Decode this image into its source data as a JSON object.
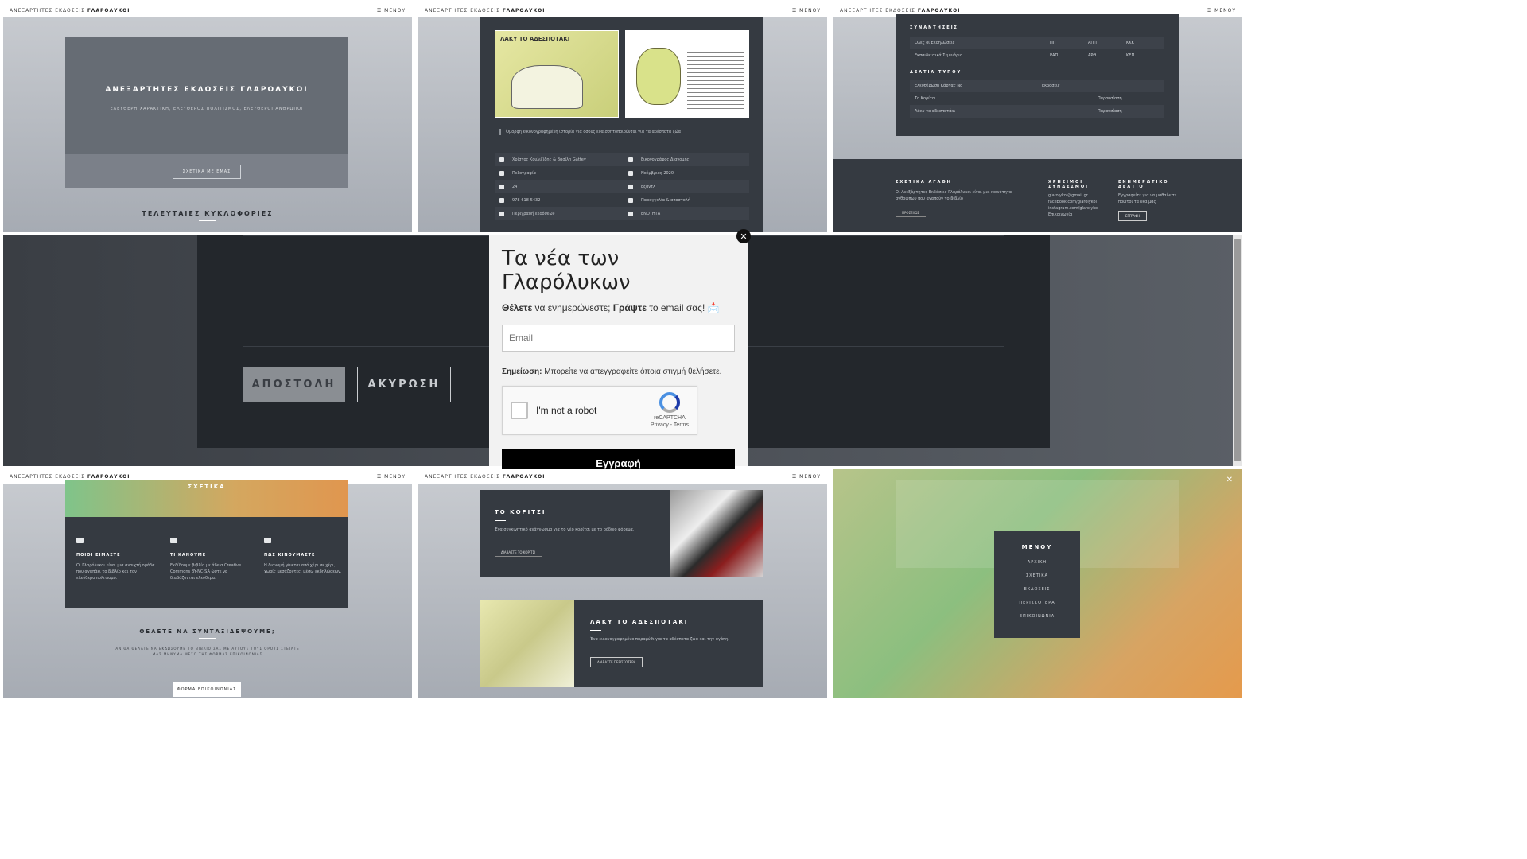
{
  "topbar": {
    "brand_prefix": "ΑΝΕΞΑΡΤΗΤΕΣ ΕΚΔΟΣΕΙΣ",
    "brand_name": "ΓΛΑΡΟΛΥΚΟΙ",
    "menu_label": "☰ ΜΕΝΟΥ"
  },
  "hero": {
    "title": "ΑΝΕΞΑΡΤΗΤΕΣ ΕΚΔΟΣΕΙΣ ΓΛΑΡΟΛΥΚΟΙ",
    "subtitle": "ΕΛΕΥΘΕΡΗ ΧΑΡΑΚΤΙΚΗ, ΕΛΕΥΘΕΡΟΣ ΠΟΛΙΤΙΣΜΟΣ, ΕΛΕΥΘΕΡΟΙ ΑΝΘΡΩΠΟΙ",
    "about_button": "ΣΧΕΤΙΚΑ ΜΕ ΕΜΑΣ",
    "latest_heading": "ΤΕΛΕΥΤΑΙΕΣ ΚΥΚΛΟΦΟΡΙΕΣ"
  },
  "book": {
    "cover_title": "ΛΑΚΥ ΤΟ ΑΔΕΣΠΟΤΑΚΙ",
    "description": "Όμορφη εικονογραφημένη ιστορία για όσους ευαισθητοποιούνται για τα αδέσποτα ζώα",
    "details": [
      {
        "left": "Χρίστος Κουλιζίδης & Βασίλη Gattey",
        "right": "Εικονογράφος Διανομής"
      },
      {
        "left": "Πεζογραφία",
        "right": "Νοέμβριος 2020"
      },
      {
        "left": "24",
        "right": "Εξαντλ"
      },
      {
        "left": "978-618-5432",
        "right": "Παραγγελία & αποστολή"
      },
      {
        "left": "Περιγραφή εκδόσεων",
        "right": "ΕΝΟΤΗΤΑ"
      }
    ]
  },
  "meetings": {
    "heading": "ΣΥΝΑΝΤΗΣΕΙΣ",
    "rows": [
      {
        "name": "Όλες οι Εκδηλώσεις",
        "a": "ΠΠ",
        "b": "ΑΠΠ",
        "c": "ΚΚΚ"
      },
      {
        "name": "Εκπαιδευτικά Σεμινάρια",
        "a": "ΡΑΠ",
        "b": "ΑΡΘ",
        "c": "ΚΕΠ"
      }
    ],
    "stock_heading": "ΔΕΛΤΙΑ ΤΥΠΟΥ",
    "stock_rows": [
      {
        "name": "Ελευθέρωση Κάρτας Νο",
        "a": "Εκδόσεις",
        "b": ""
      },
      {
        "name": "Το Κορίτσι",
        "a": "",
        "b": "Παρουσίαση"
      },
      {
        "name": "Λάκυ το αδεσποτάκι",
        "a": "",
        "b": "Παρουσίαση"
      }
    ]
  },
  "footer": {
    "about_heading": "ΣΧΕΤΙΚΑ ΑΓΑΘΗ",
    "about_text": "Οι Ανεξάρτητες Εκδόσεις Γλαρόλυκοι είναι μια κοινότητα ανθρώπων που αγαπούν το βιβλίο",
    "about_button": "ΠΡΟΣΕΧΩΣ",
    "links_heading": "ΧΡΗΣΙΜΟΙ ΣΥΝΔΕΣΜΟΙ",
    "links": [
      "glarolykoi@gmail.gr",
      "facebook.com/glarolykoi",
      "instagram.com/glarolykoi",
      "Επικοινωνία"
    ],
    "news_heading": "ΕΝΗΜΕΡΩΤΙΚΟ ΔΕΛΤΙΟ",
    "news_text": "Εγγραφείτε για να μαθαίνετε πρώτοι τα νέα μας",
    "news_button": "ΕΓΓΡΑΦΗ"
  },
  "form": {
    "send_button": "ΑΠΟΣΤΟΛΗ",
    "cancel_button": "ΑΚΥΡΩΣΗ"
  },
  "popup": {
    "title": "Τα νέα των Γλαρόλυκων",
    "sub_bold1": "Θέλετε",
    "sub_mid": "να ενημερώνεστε;",
    "sub_bold2": "Γράψτε",
    "sub_end": "το email σας! 📩",
    "email_placeholder": "Email",
    "note_bold": "Σημείωση:",
    "note_text": "Μπορείτε να απεγγραφείτε όποια στιγμή θελήσετε.",
    "captcha_label": "I'm not a robot",
    "captcha_brand": "reCAPTCHA",
    "captcha_links": "Privacy - Terms",
    "subscribe_button": "Εγγραφή",
    "close": "✕"
  },
  "about": {
    "title": "ΣΧΕΤΙΚΑ",
    "cols": [
      {
        "heading": "ΠΟΙΟΙ ΕΙΜΑΣΤΕ",
        "text": "Οι Γλαρόλυκοι είναι μια ανοιχτή ομάδα που αγαπάει το βιβλίο και τον ελεύθερο πολιτισμό."
      },
      {
        "heading": "ΤΙ ΚΑΝΟΥΜΕ",
        "text": "Εκδίδουμε βιβλία με άδεια Creative Commons BY-NC-SA ώστε να διαβάζονται ελεύθερα."
      },
      {
        "heading": "ΠΩΣ ΚΙΝΟΥΜΑΣΤΕ",
        "text": "Η διανομή γίνεται από χέρι σε χέρι, χωρίς μεσάζοντες, μέσω εκδηλώσεων."
      }
    ],
    "collab_heading": "ΘΕΛΕΤΕ ΝΑ ΣΥΝΤΑΞΙΔΕΨΟΥΜΕ;",
    "collab_text": "ΑΝ ΘΑ ΘΕΛΑΤΕ ΝΑ ΕΚΔΩΣΟΥΜΕ ΤΟ ΒΙΒΛΙΟ ΣΑΣ ΜΕ ΑΥΤΟΥΣ ΤΟΥΣ ΟΡΟΥΣ ΣΤΕΙΛΤΕ ΜΑΣ ΜΗΝΥΜΑ ΜΕΣΩ ΤΗΣ ΦΟΡΜΑΣ ΕΠΙΚΟΙΝΩΝΙΑΣ",
    "contact_button": "ΦΟΡΜΑ ΕΠΙΚΟΙΝΩΝΙΑΣ"
  },
  "releases": [
    {
      "title": "ΤΟ ΚΟΡΙΤΣΙ",
      "text": "Ένα συγκινητικό ανάγνωσμα για το νέο κορίτσι με το ρόδινο φόρεμα.",
      "button": "ΔΙΑΒΑΣΤΕ ΤΟ ΚΟΡΙΤΣΙ"
    },
    {
      "title": "ΛΑΚΥ ΤΟ ΑΔΕΣΠΟΤΑΚΙ",
      "text": "Ένα εικονογραφημένο παραμύθι για τα αδέσποτα ζώα και την αγάπη.",
      "button": "ΔΙΑΒΑΣΤΕ ΠΕΡΙΣΣΟΤΕΡΑ"
    }
  ],
  "overlay_menu": {
    "title": "ΜΕΝΟΥ",
    "items": [
      "ΑΡΧΙΚΗ",
      "ΣΧΕΤΙΚΑ",
      "ΕΚΔΟΣΕΙΣ",
      "ΠΕΡΙΣΣΟΤΕΡΑ",
      "ΕΠΙΚΟΙΝΩΝΙΑ"
    ],
    "close": "✕"
  },
  "colors": {
    "accent_green": "#7fbf7f",
    "accent_orange": "#e0964f",
    "dark_card": "#353a41"
  }
}
